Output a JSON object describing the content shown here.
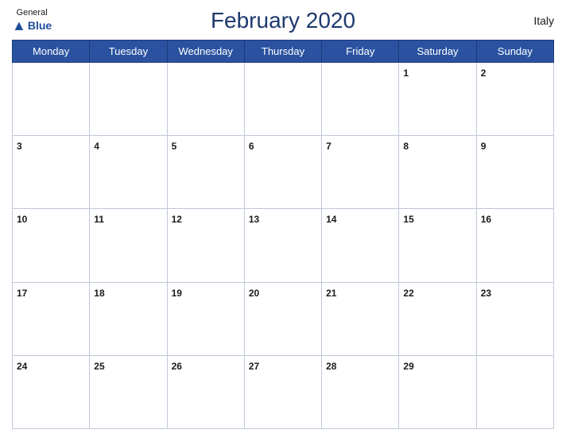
{
  "header": {
    "title": "February 2020",
    "country": "Italy",
    "logo_general": "General",
    "logo_blue": "Blue"
  },
  "days_of_week": [
    "Monday",
    "Tuesday",
    "Wednesday",
    "Thursday",
    "Friday",
    "Saturday",
    "Sunday"
  ],
  "weeks": [
    [
      null,
      null,
      null,
      null,
      null,
      1,
      2
    ],
    [
      3,
      4,
      5,
      6,
      7,
      8,
      9
    ],
    [
      10,
      11,
      12,
      13,
      14,
      15,
      16
    ],
    [
      17,
      18,
      19,
      20,
      21,
      22,
      23
    ],
    [
      24,
      25,
      26,
      27,
      28,
      29,
      null
    ]
  ],
  "colors": {
    "header_bg": "#2a52a0",
    "header_text": "#ffffff",
    "title_color": "#1e3a6e",
    "logo_color": "#1e4d9b",
    "cell_border": "#c0c8d8"
  }
}
